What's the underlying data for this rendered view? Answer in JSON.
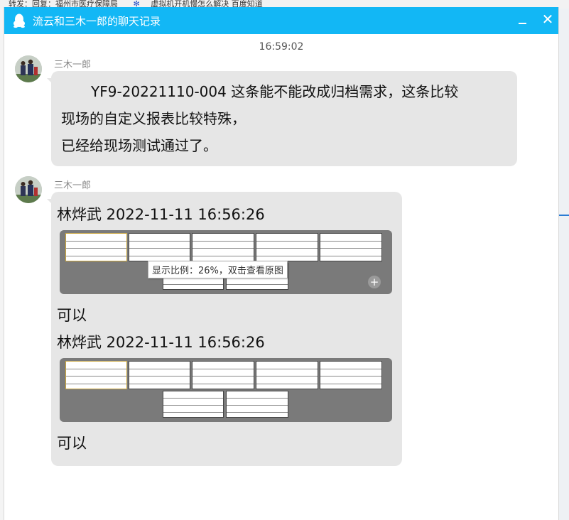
{
  "background": {
    "taskbar_text_1": "转发：回复：福州市医疗保障局",
    "taskbar_text_2": "虚拟机开机慢怎么解决 百度知道"
  },
  "window": {
    "title": "流云和三木一郎的聊天记录",
    "accent_color": "#12b7f5"
  },
  "timestamp": "16:59:02",
  "messages": [
    {
      "sender": "三木一郎",
      "lines": [
        "YF9-20221110-004  这条能不能改成归档需求，这条比较",
        "现场的自定义报表比较特殊，",
        "已经给现场测试通过了。"
      ]
    },
    {
      "sender": "三木一郎",
      "header1": "林烨武 2022-11-11 16:56:26",
      "tooltip": "显示比例：26%，双击查看原图",
      "reply1": "可以",
      "header2": "林烨武 2022-11-11 16:56:26",
      "reply2": "可以"
    }
  ],
  "icons": {
    "app": "qq-penguin-icon",
    "minimize": "minimize-icon",
    "close": "close-icon",
    "zoom": "zoom-in-icon"
  }
}
